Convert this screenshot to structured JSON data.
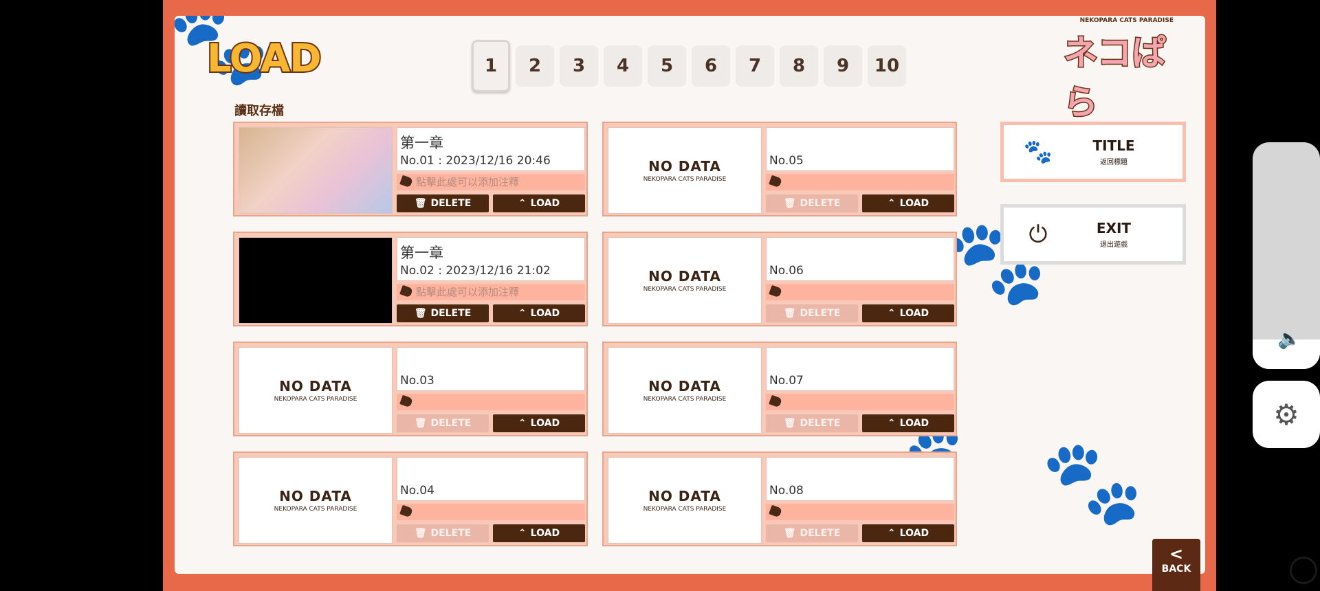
{
  "header": {
    "title": "LOAD",
    "subtitle": "讀取存檔",
    "brand_top": "NEKOPARA CATS PARADISE",
    "brand_name": "ネコぱら"
  },
  "tabs": [
    "1",
    "2",
    "3",
    "4",
    "5",
    "6",
    "7",
    "8",
    "9",
    "10"
  ],
  "active_tab": "1",
  "slots": [
    {
      "chapter": "第一章",
      "save_no": "No.01 : 2023/12/16 20:46",
      "note": "點擊此處可以添加注釋",
      "thumb": "image",
      "delete_enabled": true
    },
    {
      "chapter": "第一章",
      "save_no": "No.02 : 2023/12/16 21:02",
      "note": "點擊此處可以添加注釋",
      "thumb": "black",
      "delete_enabled": true
    },
    {
      "chapter": "",
      "save_no": "No.03",
      "note": "",
      "thumb": "none",
      "delete_enabled": false
    },
    {
      "chapter": "",
      "save_no": "No.04",
      "note": "",
      "thumb": "none",
      "delete_enabled": false
    },
    {
      "chapter": "",
      "save_no": "No.05",
      "note": "",
      "thumb": "none",
      "delete_enabled": false
    },
    {
      "chapter": "",
      "save_no": "No.06",
      "note": "",
      "thumb": "none",
      "delete_enabled": false
    },
    {
      "chapter": "",
      "save_no": "No.07",
      "note": "",
      "thumb": "none",
      "delete_enabled": false
    },
    {
      "chapter": "",
      "save_no": "No.08",
      "note": "",
      "thumb": "none",
      "delete_enabled": false
    }
  ],
  "no_data": {
    "title": "NO DATA",
    "subtitle": "NEKOPARA CATS PARADISE"
  },
  "buttons": {
    "delete": "DELETE",
    "load": "LOAD"
  },
  "side": {
    "title_main": "TITLE",
    "title_sub": "返回標題",
    "exit_main": "EXIT",
    "exit_sub": "退出遊戲"
  },
  "back_label": "BACK",
  "icons": {
    "title": "paw-icon",
    "exit": "power-icon",
    "settings": "gear-icon",
    "volume": "speaker-icon"
  },
  "colors": {
    "frame": "#e8684a",
    "slot_bg": "#f8c9b8",
    "note_bar": "#fdb39d",
    "dark_button": "#4c2710"
  },
  "volume_level": 0.13
}
